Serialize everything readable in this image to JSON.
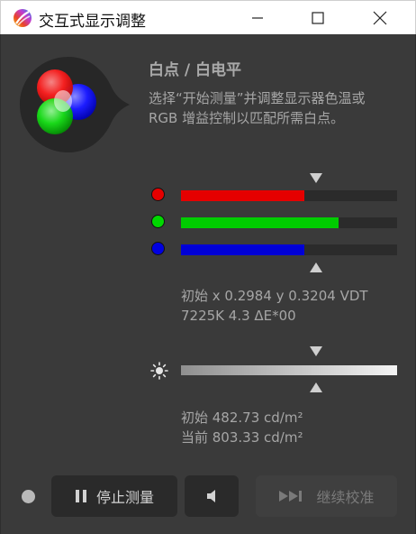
{
  "window": {
    "title": "交互式显示调整",
    "icons": [
      "app-icon",
      "minimize-icon",
      "maximize-icon",
      "close-icon"
    ]
  },
  "header": {
    "title": "白点 / 白电平",
    "description_lines": [
      "选择“开始测量”并调整显示器色温或",
      "RGB 增益控制以匹配所需白点。"
    ]
  },
  "rgb": {
    "channels": [
      {
        "name": "red",
        "color": "#e50000",
        "level": 0.57
      },
      {
        "name": "green",
        "color": "#00cc00",
        "level": 0.73
      },
      {
        "name": "blue",
        "color": "#0000d6",
        "level": 0.57
      }
    ],
    "target_marker": 0.625
  },
  "whitepoint_readout": {
    "line1": "初始 x 0.2984 y 0.3204 VDT",
    "line2": "7225K 4.3 ΔE*00"
  },
  "luminance": {
    "icon": "brightness-icon",
    "target_marker": 0.625,
    "line1": "初始 482.73 cd/m²",
    "line2": "当前 803.33 cd/m²"
  },
  "buttons": {
    "stop_label": "停止测量",
    "stop_icon": "pause-icon",
    "sound_icon": "speaker-icon",
    "continue_label": "继续校准",
    "continue_icon": "skip-forward-icon"
  },
  "colors": {
    "background": "#3a3a3a",
    "button": "#2a2a2a",
    "button_disabled": "#3f3f3f",
    "text": "#a6a6a6"
  }
}
